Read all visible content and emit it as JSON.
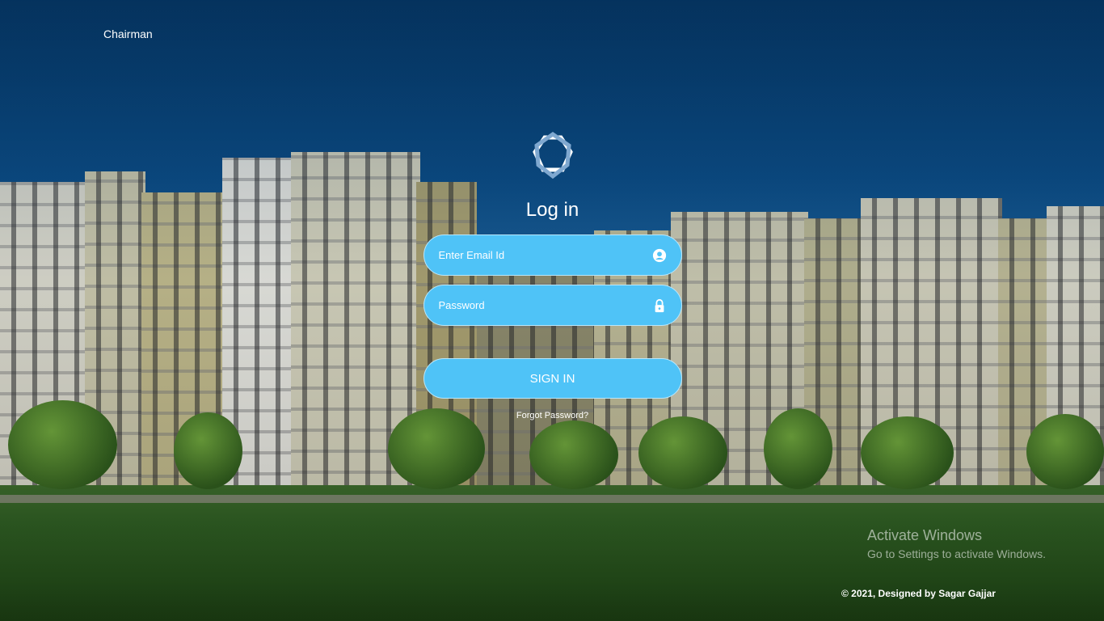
{
  "header": {
    "brand": "Chairman"
  },
  "login": {
    "title": "Log in",
    "email_placeholder": "Enter Email Id",
    "password_placeholder": "Password",
    "signin_label": "SIGN IN",
    "forgot_label": "Forgot Password?"
  },
  "watermark": {
    "line1": "Activate Windows",
    "line2": "Go to Settings to activate Windows."
  },
  "footer": {
    "text": "© 2021, Designed by Sagar Gajjar"
  },
  "colors": {
    "accent": "#4fc3f7",
    "background": "#0b4a80"
  },
  "icons": {
    "email": "user-circle-icon",
    "password": "lock-icon",
    "logo": "interlaced-star-logo"
  }
}
